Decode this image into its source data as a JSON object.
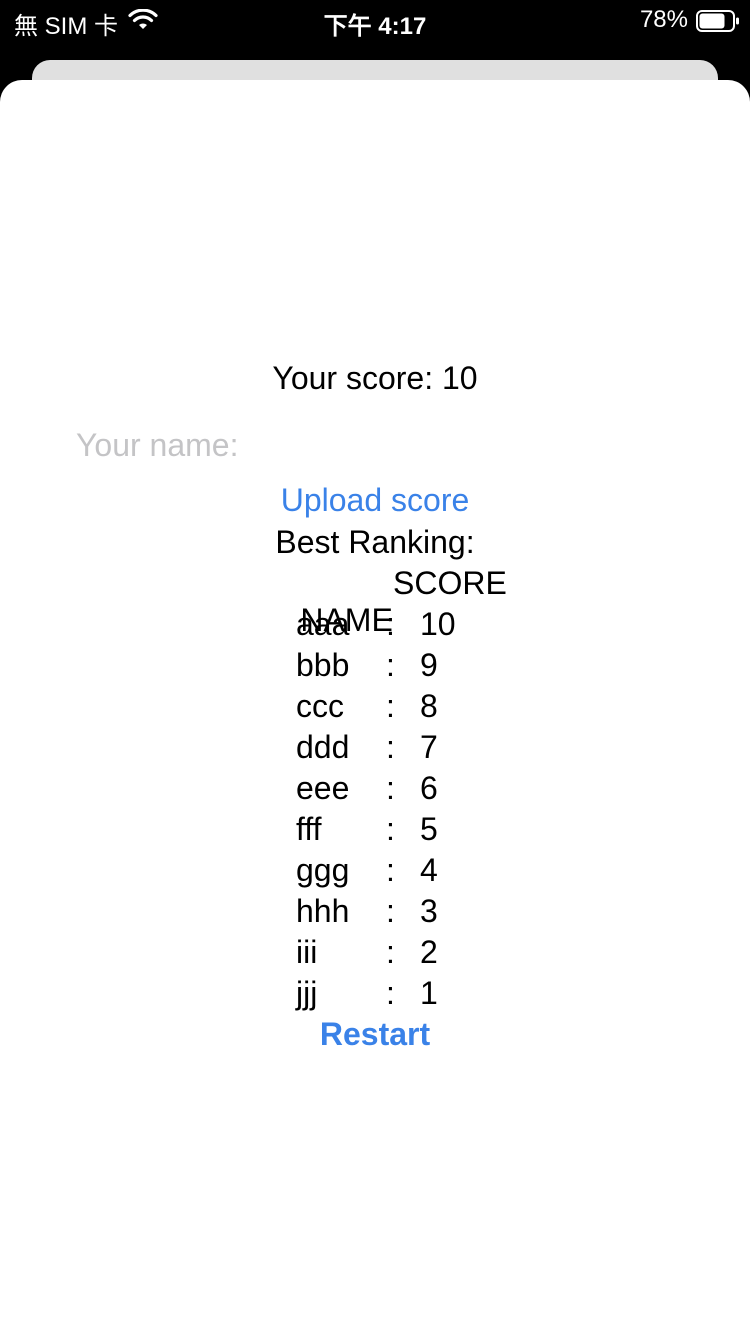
{
  "status_bar": {
    "carrier": "無 SIM 卡",
    "time": "下午 4:17",
    "battery_percent": "78%",
    "battery_level": 0.78,
    "wifi_icon": "wifi-icon",
    "battery_icon": "battery-icon"
  },
  "game_over": {
    "score_text": "Your score: 10",
    "name_placeholder": "Your name:",
    "name_value": "",
    "upload_label": "Upload score",
    "ranking_title": "Best Ranking:",
    "header_name": "NAME",
    "header_score": "SCORE",
    "rankings": [
      {
        "name": "aaa",
        "sep": ":",
        "score": "10"
      },
      {
        "name": "bbb",
        "sep": ":",
        "score": "9"
      },
      {
        "name": "ccc",
        "sep": ":",
        "score": "8"
      },
      {
        "name": "ddd",
        "sep": ":",
        "score": "7"
      },
      {
        "name": "eee",
        "sep": ":",
        "score": "6"
      },
      {
        "name": "fff",
        "sep": ":",
        "score": "5"
      },
      {
        "name": "ggg",
        "sep": ":",
        "score": "4"
      },
      {
        "name": "hhh",
        "sep": ":",
        "score": "3"
      },
      {
        "name": "iii",
        "sep": ":",
        "score": "2"
      },
      {
        "name": "jjj",
        "sep": ":",
        "score": "1"
      }
    ],
    "restart_label": "Restart"
  },
  "colors": {
    "link": "#3a82e8",
    "placeholder": "#c4c4c6"
  }
}
